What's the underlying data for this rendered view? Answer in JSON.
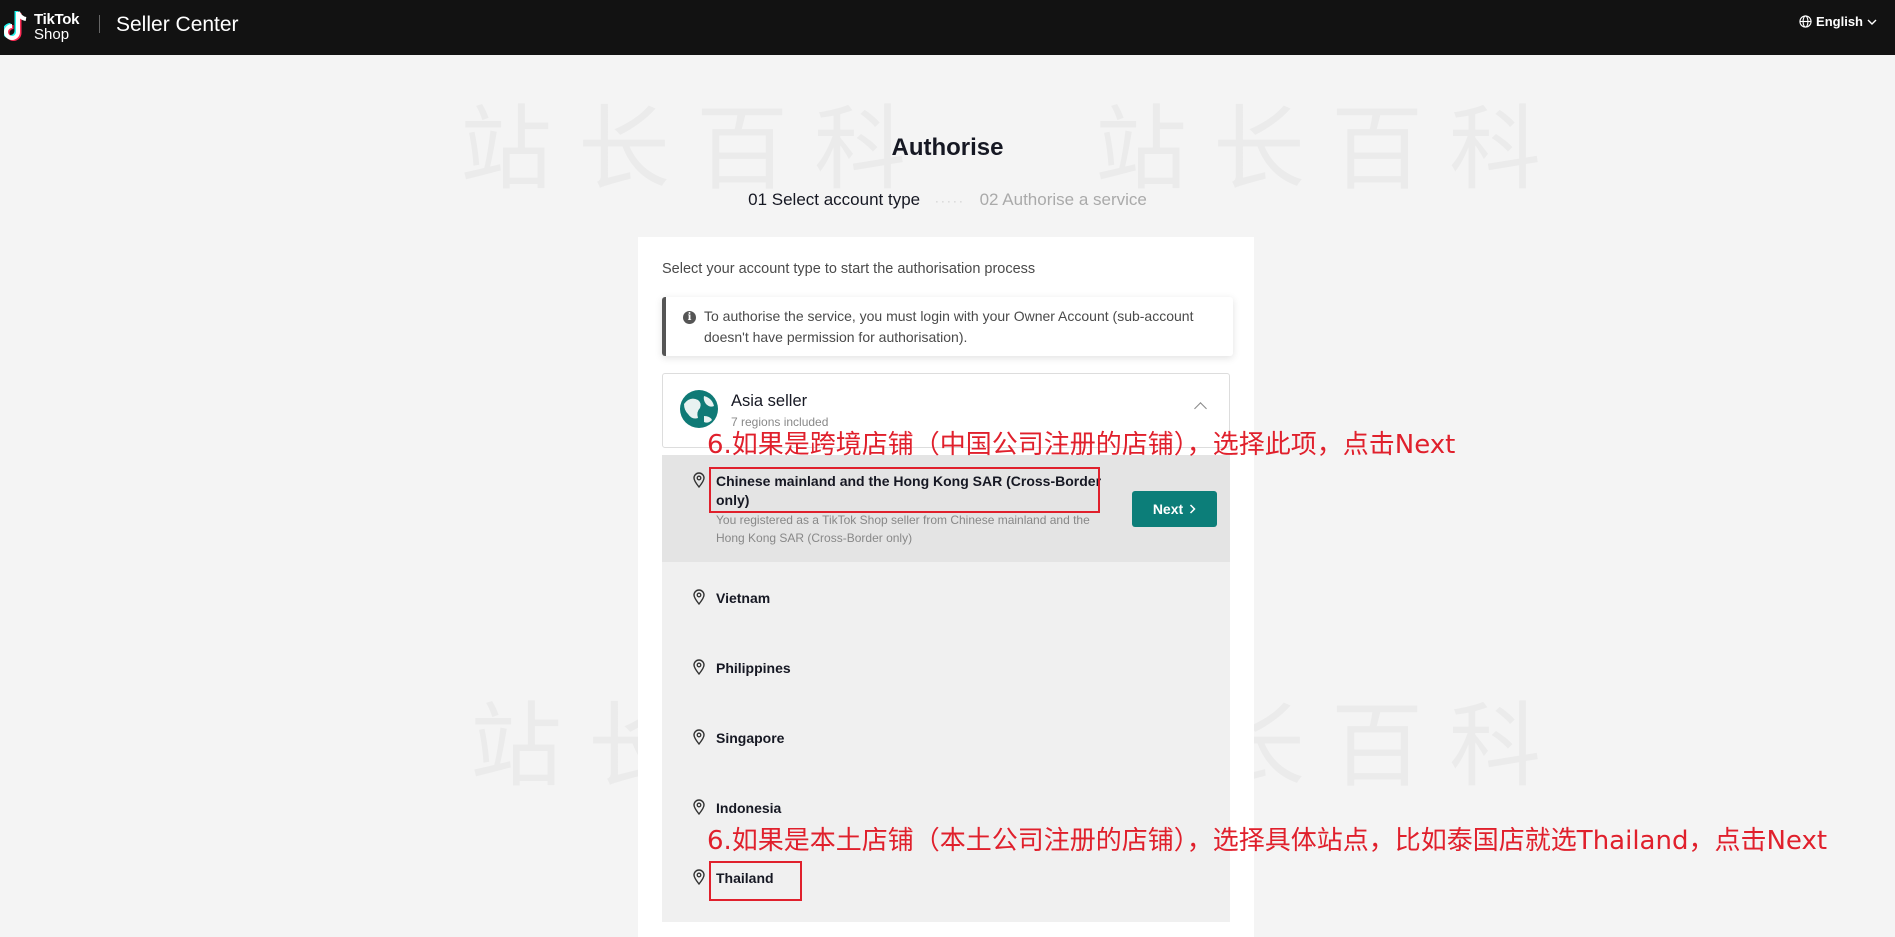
{
  "header": {
    "logo_line1": "TikTok",
    "logo_line2": "Shop",
    "app_title": "Seller Center",
    "language": "English"
  },
  "watermark_text": "站长百科",
  "page": {
    "title": "Authorise",
    "step1": "01 Select account type",
    "step2": "02 Authorise a service",
    "subtitle": "Select your account type to start the authorisation process",
    "notice": "To authorise the service, you must login with your Owner Account (sub-account doesn't have permission for authorisation)."
  },
  "seller_group": {
    "title": "Asia seller",
    "subtitle": "7 regions included"
  },
  "regions": [
    {
      "name": "Chinese mainland and the Hong Kong SAR (Cross-Border only)",
      "description": "You registered as a TikTok Shop seller from Chinese mainland and the Hong Kong SAR (Cross-Border only)",
      "selected": true
    },
    {
      "name": "Vietnam"
    },
    {
      "name": "Philippines"
    },
    {
      "name": "Singapore"
    },
    {
      "name": "Indonesia"
    },
    {
      "name": "Thailand"
    }
  ],
  "next_button": "Next",
  "annotations": {
    "cross_border": "6.如果是跨境店铺（中国公司注册的店铺），选择此项，点击Next",
    "local": "6.如果是本土店铺（本土公司注册的店铺），选择具体站点，比如泰国店就选Thailand，点击Next"
  },
  "colors": {
    "topbar": "#121212",
    "accent": "#0c7e79",
    "annotation_red": "#e0202c"
  }
}
